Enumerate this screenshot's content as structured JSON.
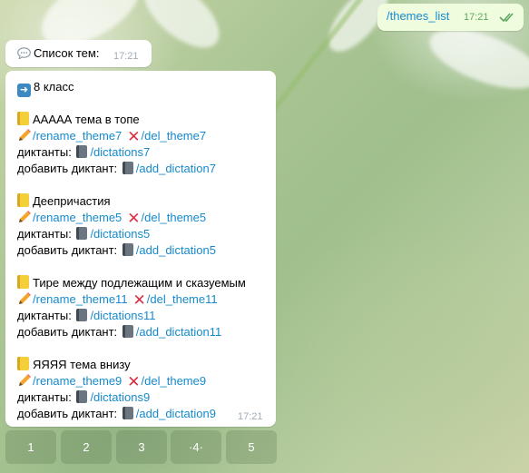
{
  "outgoing": {
    "text": "/themes_list",
    "time": "17:21"
  },
  "header_message": {
    "text": "Список тем:",
    "time": "17:21"
  },
  "list_message": {
    "class_label": "8 класс",
    "time": "17:21",
    "dictations_label": "диктанты:",
    "add_dictation_label": "добавить диктант:",
    "themes": [
      {
        "title": "ААААА тема в топе",
        "rename": "/rename_theme7",
        "delete": "/del_theme7",
        "dictations": "/dictations7",
        "add": "/add_dictation7"
      },
      {
        "title": "Деепричастия",
        "rename": "/rename_theme5",
        "delete": "/del_theme5",
        "dictations": "/dictations5",
        "add": "/add_dictation5"
      },
      {
        "title": "Тире между подлежащим и сказуемым",
        "rename": "/rename_theme11",
        "delete": "/del_theme11",
        "dictations": "/dictations11",
        "add": "/add_dictation11"
      },
      {
        "title": "ЯЯЯЯ тема внизу",
        "rename": "/rename_theme9",
        "delete": "/del_theme9",
        "dictations": "/dictations9",
        "add": "/add_dictation9"
      }
    ]
  },
  "keyboard": {
    "buttons": [
      "1",
      "2",
      "3",
      "·4·",
      "5"
    ]
  },
  "colors": {
    "link": "#168acd",
    "outgoing_bg": "#effdde",
    "cross": "#dd2e44"
  }
}
